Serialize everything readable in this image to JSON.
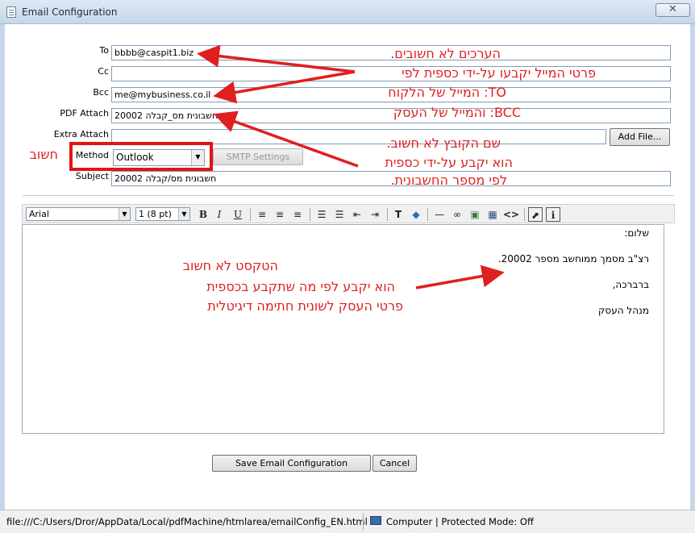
{
  "window": {
    "title": "Email Configuration",
    "close_glyph": "✕"
  },
  "form": {
    "to_label": "To",
    "to_value": "bbbb@caspit1.biz",
    "cc_label": "Cc",
    "cc_value": "",
    "bcc_label": "Bcc",
    "bcc_value": "me@mybusiness.co.il",
    "pdf_label": "PDF Attach",
    "pdf_value": "חשבונית מס_קבלה 20002",
    "extra_label": "Extra Attach",
    "extra_value": "",
    "add_file_label": "Add File...",
    "method_label": "Method",
    "method_value": "Outlook",
    "smtp_label": "SMTP Settings",
    "subject_label": "Subject",
    "subject_value": "חשבונית מס/קבלה 20002"
  },
  "editor": {
    "font_value": "Arial",
    "size_value": "1 (8 pt)",
    "bold": "B",
    "italic": "I",
    "underline": "U",
    "body_lines": [
      "שלום:",
      "רצ\"ב מסמך ממוחשב מספר 20002.",
      "ברברכה,",
      "מנהל העסק"
    ]
  },
  "footer": {
    "save_label": "Save Email Configuration",
    "cancel_label": "Cancel"
  },
  "statusbar": {
    "url": "file:///C:/Users/Dror/AppData/Local/pdfMachine/htmlarea/emailConfig_EN.html",
    "zone": "Computer | Protected Mode: Off"
  },
  "annotations": {
    "values_note": "הערכים לא חשובים.",
    "email_note": "פרטי המייל יקבעו על-ידי כספית לפי",
    "to_note": "TO: המייל של הלקוח",
    "bcc_note": "BCC: והמייל של העסק",
    "file_note_1": "שם הקובץ לא חשוב.",
    "file_note_2": "הוא יקבע על-ידי כספית",
    "file_note_3": "לפי מספר החשבונית.",
    "important_note": "חשוב",
    "text_note_1": "הטקסט לא חשוב",
    "text_note_2": "הוא יקבע לפי מה שתקבע בכספית",
    "text_note_3": "פרטי העסק לשונית חתימה דיגיטלית"
  },
  "colors": {
    "annotation": "#e01f1f",
    "titlebar": "#c6d6ea"
  }
}
